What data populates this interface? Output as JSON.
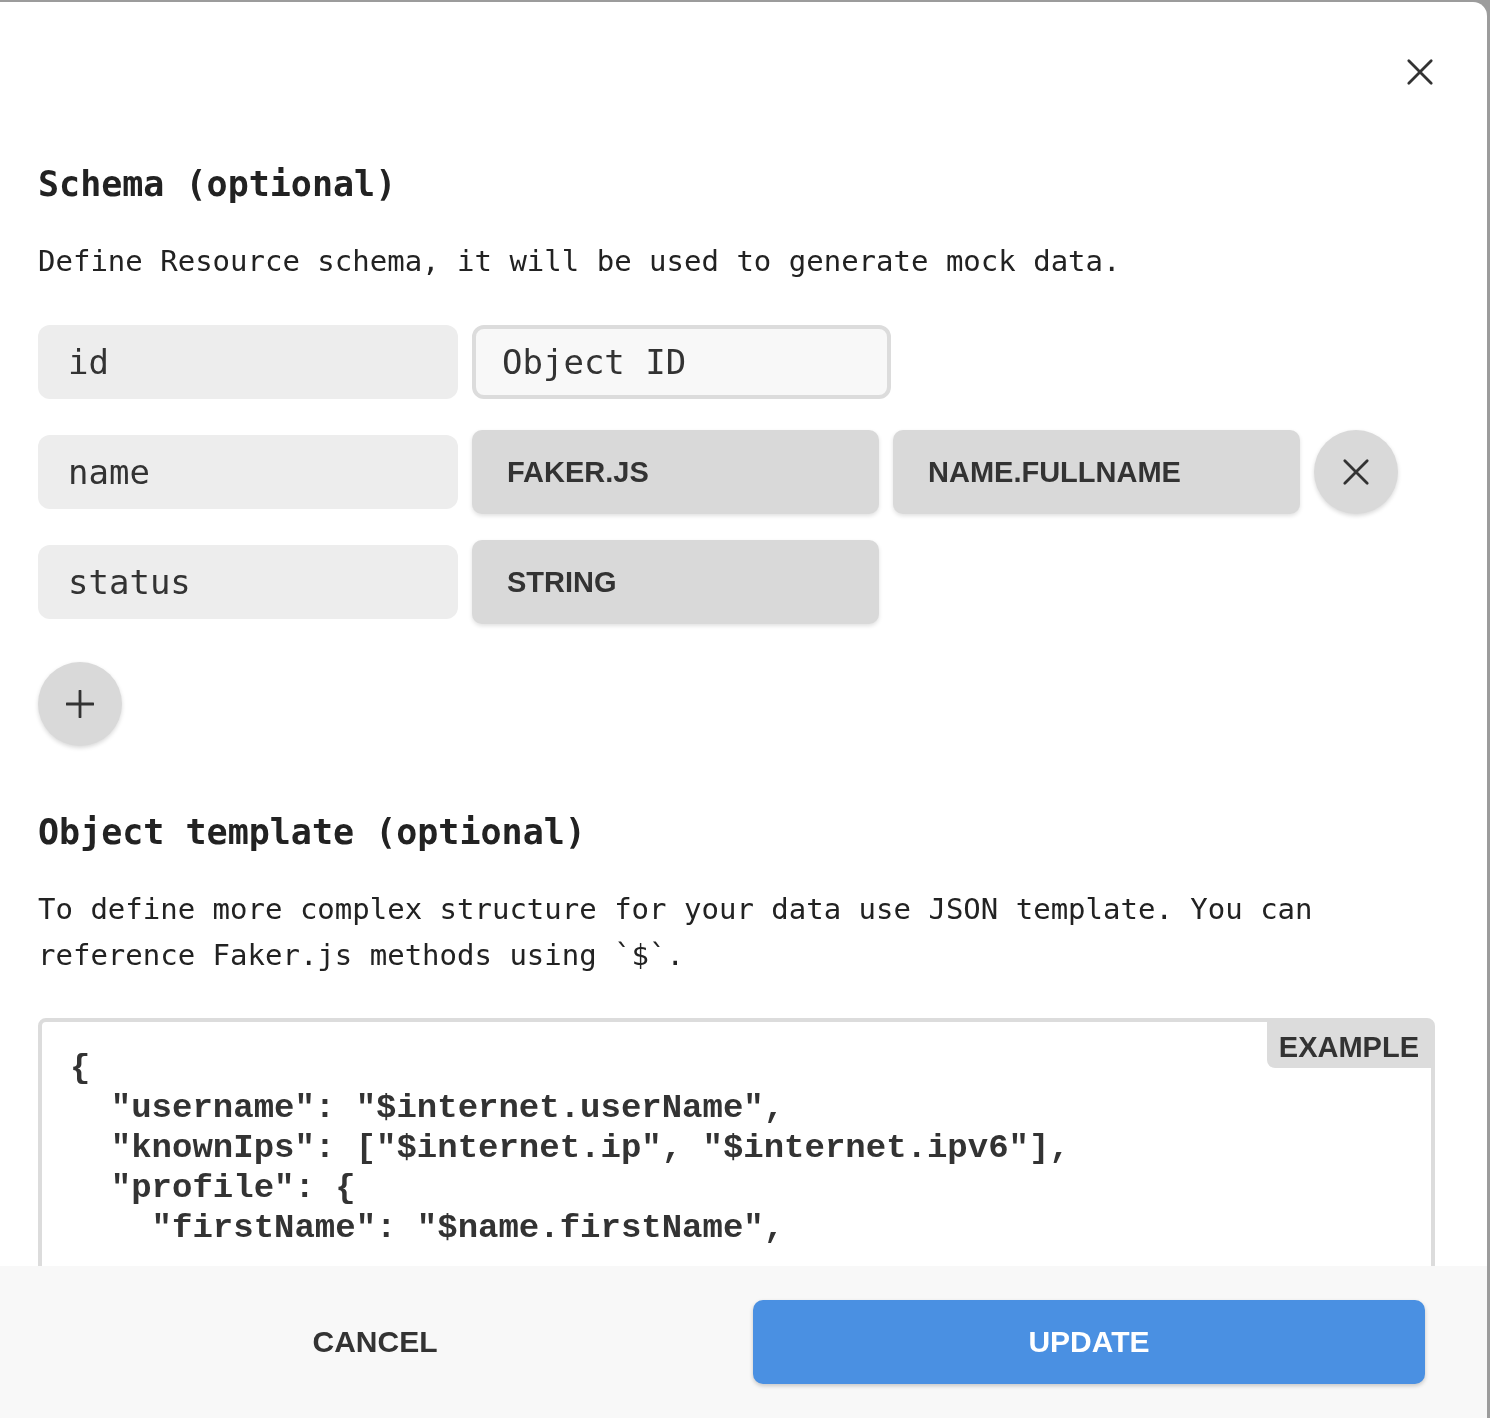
{
  "schema": {
    "title": "Schema (optional)",
    "description": "Define Resource schema, it will be used to generate mock data.",
    "rows": [
      {
        "name": "id",
        "values": [
          {
            "kind": "input",
            "text": "Object ID"
          }
        ],
        "remove_shown": false
      },
      {
        "name": "name",
        "values": [
          {
            "kind": "select",
            "text": "FAKER.JS"
          },
          {
            "kind": "select",
            "text": "NAME.FULLNAME"
          }
        ],
        "remove_shown": true
      },
      {
        "name": "status",
        "values": [
          {
            "kind": "select",
            "text": "STRING"
          }
        ],
        "remove_shown": false
      }
    ]
  },
  "template": {
    "title": "Object template (optional)",
    "description": "To define more complex structure for your data use JSON template. You can reference Faker.js methods using `$`.",
    "example_label": "EXAMPLE",
    "code_lines": [
      "{",
      "  \"username\": \"$internet.userName\",",
      "  \"knownIps\": [\"$internet.ip\", \"$internet.ipv6\"],",
      "  \"profile\": {",
      "    \"firstName\": \"$name.firstName\","
    ]
  },
  "buttons": {
    "cancel": "CANCEL",
    "update": "UPDATE"
  }
}
